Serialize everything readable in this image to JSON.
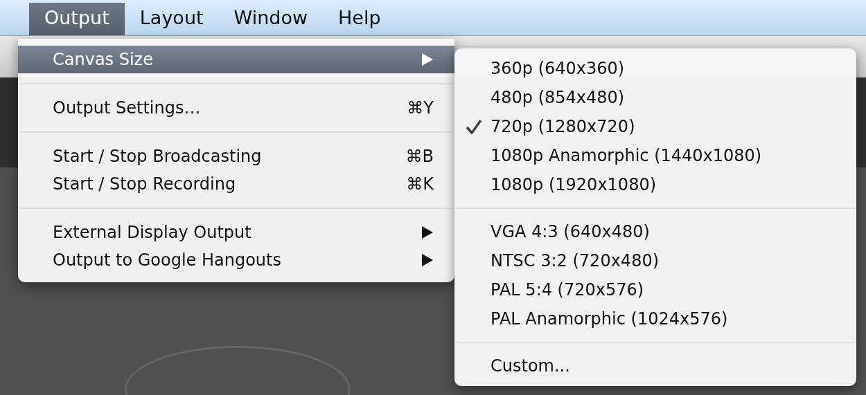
{
  "menu_bar": [
    {
      "label": "Output",
      "selected": true
    },
    {
      "label": "Layout",
      "selected": false
    },
    {
      "label": "Window",
      "selected": false
    },
    {
      "label": "Help",
      "selected": false
    }
  ],
  "menu": {
    "sections": [
      [
        {
          "label": "Canvas Size",
          "submenu": true,
          "selected": true
        }
      ],
      [
        {
          "label": "Output Settings…",
          "shortcut": "⌘Y",
          "submenu": false,
          "selected": false
        }
      ],
      [
        {
          "label": "Start / Stop Broadcasting",
          "shortcut": "⌘B",
          "submenu": false,
          "selected": false
        },
        {
          "label": "Start / Stop Recording",
          "shortcut": "⌘K",
          "submenu": false,
          "selected": false
        }
      ],
      [
        {
          "label": "External Display Output",
          "submenu": true,
          "selected": false
        },
        {
          "label": "Output to Google Hangouts",
          "submenu": true,
          "selected": false
        }
      ]
    ]
  },
  "submenu": {
    "sections": [
      [
        {
          "label": "360p (640x360)",
          "checked": false
        },
        {
          "label": "480p (854x480)",
          "checked": false
        },
        {
          "label": "720p (1280x720)",
          "checked": true
        },
        {
          "label": "1080p Anamorphic (1440x1080)",
          "checked": false
        },
        {
          "label": "1080p (1920x1080)",
          "checked": false
        }
      ],
      [
        {
          "label": "VGA 4:3 (640x480)",
          "checked": false
        },
        {
          "label": "NTSC 3:2 (720x480)",
          "checked": false
        },
        {
          "label": "PAL 5:4 (720x576)",
          "checked": false
        },
        {
          "label": "PAL Anamorphic (1024x576)",
          "checked": false
        }
      ],
      [
        {
          "label": "Custom...",
          "checked": false
        }
      ]
    ]
  }
}
